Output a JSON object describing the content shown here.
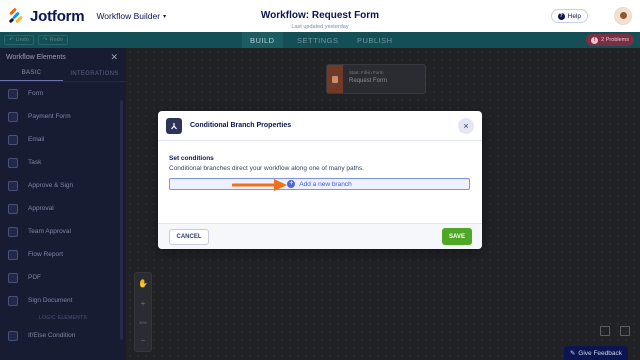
{
  "header": {
    "logo_text": "Jotform",
    "builder_label": "Workflow Builder",
    "title": "Workflow: Request Form",
    "subtitle": "Last updated yesterday",
    "help_label": "Help"
  },
  "toolbar": {
    "undo_label": "Undo",
    "redo_label": "Redo",
    "tabs": [
      {
        "label": "BUILD"
      },
      {
        "label": "SETTINGS"
      },
      {
        "label": "PUBLISH"
      }
    ],
    "problems_label": "2 Problems"
  },
  "sidebar": {
    "title": "Workflow Elements",
    "tabs": [
      {
        "label": "BASIC"
      },
      {
        "label": "INTEGRATIONS"
      }
    ],
    "items": [
      {
        "label": "Form"
      },
      {
        "label": "Payment Form"
      },
      {
        "label": "Email"
      },
      {
        "label": "Task"
      },
      {
        "label": "Approve & Sign"
      },
      {
        "label": "Approval"
      },
      {
        "label": "Team Approval"
      },
      {
        "label": "Flow Report"
      },
      {
        "label": "PDF"
      },
      {
        "label": "Sign Document"
      }
    ],
    "section_label": "LOGIC ELEMENTS",
    "logic_items": [
      {
        "label": "If/Else Condition"
      }
    ]
  },
  "canvas": {
    "node": {
      "kind": "Start: Fill-in Form",
      "name": "Request Form"
    },
    "zoom": "30%",
    "feedback_label": "Give Feedback"
  },
  "modal": {
    "title": "Conditional Branch Properties",
    "section_title": "Set conditions",
    "description": "Conditional branches direct your workflow along one of many paths.",
    "add_branch_label": "Add a new branch",
    "cancel_label": "CANCEL",
    "save_label": "SAVE"
  },
  "colors": {
    "brand_navy": "#0a1551",
    "save_green": "#4ea825",
    "arrow_orange": "#f36f1a",
    "accent_blue": "#3d5bd8"
  }
}
